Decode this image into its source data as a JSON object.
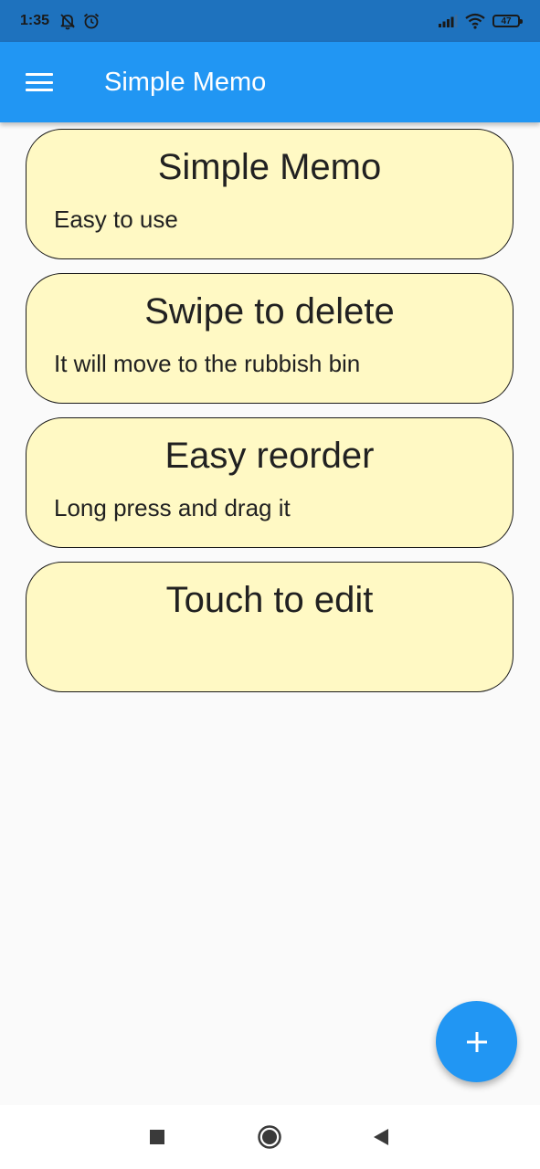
{
  "status_bar": {
    "time": "1:35",
    "battery_level": "47",
    "left_icons": [
      "bell-off-icon",
      "alarm-clock-icon"
    ],
    "right_icons": [
      "signal-icon",
      "wifi-icon",
      "battery-icon"
    ]
  },
  "app_bar": {
    "title": "Simple Memo",
    "menu_icon": "hamburger-menu-icon"
  },
  "memos": [
    {
      "title": "Simple Memo",
      "body": "Easy to use"
    },
    {
      "title": "Swipe to delete",
      "body": "It will move to the rubbish bin"
    },
    {
      "title": "Easy reorder",
      "body": "Long press and drag it"
    },
    {
      "title": "Touch to edit",
      "body": ""
    }
  ],
  "fab": {
    "icon": "plus-icon"
  },
  "nav_bar": {
    "buttons": [
      "recents-square-icon",
      "home-circle-icon",
      "back-triangle-icon"
    ]
  },
  "colors": {
    "status_bar": "#1e72be",
    "app_bar": "#2196f3",
    "card_background": "#fff9c4",
    "fab": "#2196f3",
    "page_background": "#fafafa"
  }
}
